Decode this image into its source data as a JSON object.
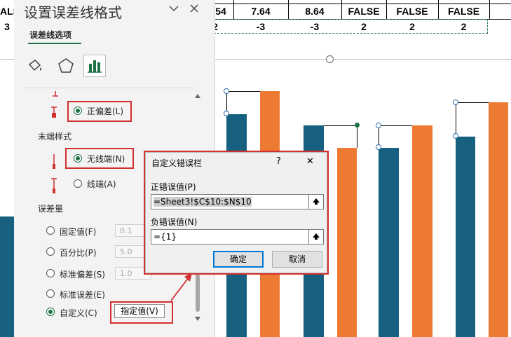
{
  "spreadsheet": {
    "row1": [
      "ALS",
      "54",
      "7.64",
      "8.64",
      "FALSE",
      "FALSE",
      "FALSE"
    ],
    "row2": [
      "3",
      "2",
      "-3",
      "-3",
      "2",
      "2",
      "2"
    ]
  },
  "chart": {
    "colors": {
      "series1": "#17607f",
      "series2": "#ed7a33"
    }
  },
  "pane": {
    "title": "设置误差线格式",
    "dropdown_icon": "chevron-down-icon",
    "close_icon": "close-icon",
    "section_label": "误差线选项",
    "tab_icons": [
      "fill-icon",
      "pentagon-icon",
      "bar-chart-icon"
    ],
    "plus_deviation": "正偏差(L)",
    "end_style_label": "末端样式",
    "no_cap": "无线端(N)",
    "cap": "线端(A)",
    "error_amount_label": "误差量",
    "options": [
      {
        "label": "固定值(F)",
        "value": "0.1"
      },
      {
        "label": "百分比(P)",
        "value": "5.0"
      },
      {
        "label": "标准偏差(S)",
        "value": "1.0"
      },
      {
        "label": "标准误差(E)"
      },
      {
        "label": "自定义(C)"
      }
    ],
    "specify_button": "指定值(V)"
  },
  "dialog": {
    "title": "自定义错误栏",
    "help": "?",
    "close": "✕",
    "pos_label": "正错误值(P)",
    "pos_value": "=Sheet3!$C$10:$N$10",
    "neg_label": "负错误值(N)",
    "neg_value": "={1}",
    "ok": "确定",
    "cancel": "取消"
  }
}
